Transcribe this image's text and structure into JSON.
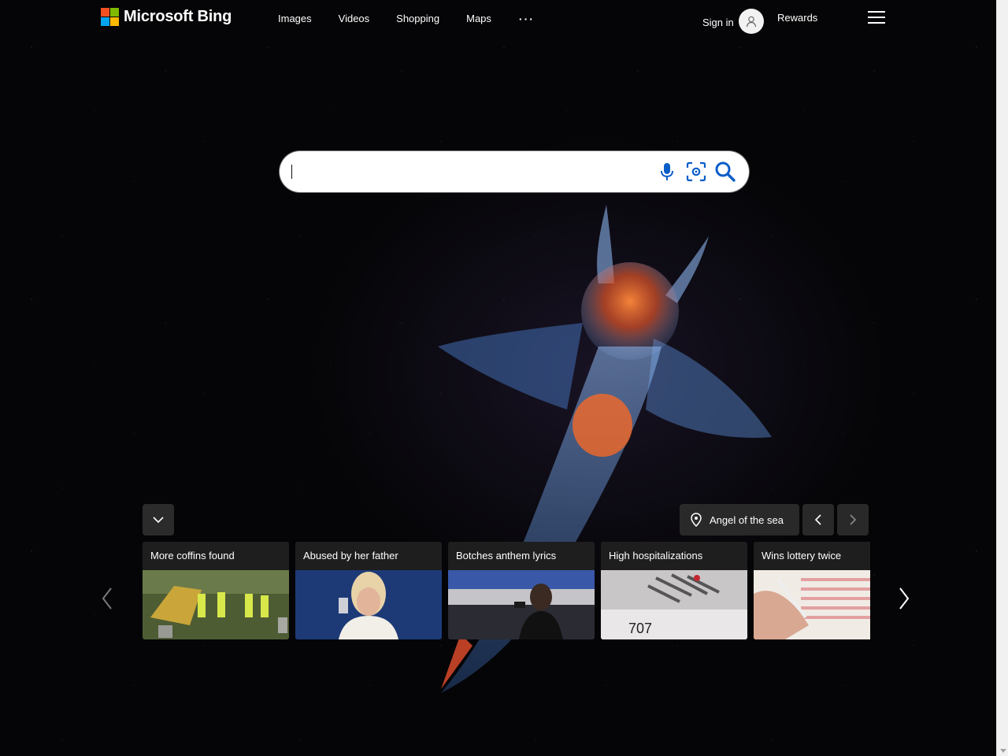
{
  "header": {
    "brand": "Microsoft Bing",
    "nav": [
      "Images",
      "Videos",
      "Shopping",
      "Maps"
    ],
    "more_label": "···",
    "signin_label": "Sign in",
    "rewards_label": "Rewards"
  },
  "search": {
    "value": "",
    "placeholder": ""
  },
  "image_info": {
    "location_label": "Angel of the sea"
  },
  "news": [
    {
      "title": "More coffins found",
      "thumb_colors": [
        "#5d6f3c",
        "#c9a53a",
        "#3d4a2a"
      ]
    },
    {
      "title": "Abused by her father",
      "thumb_colors": [
        "#1d3a77",
        "#d7b79a",
        "#f2efe8"
      ]
    },
    {
      "title": "Botches anthem lyrics",
      "thumb_colors": [
        "#2b2b33",
        "#3a58a8",
        "#111111"
      ]
    },
    {
      "title": "High hospitalizations",
      "thumb_colors": [
        "#c9c6c8",
        "#a9a3a8",
        "#7a1f28"
      ]
    },
    {
      "title": "Wins lottery twice",
      "thumb_colors": [
        "#e8cfc0",
        "#d9a892",
        "#f1ebe6"
      ]
    }
  ],
  "colors": {
    "ms_red": "#f25022",
    "ms_green": "#7fba00",
    "ms_blue": "#00a4ef",
    "ms_yellow": "#ffb900",
    "search_icon": "#0b5ec9"
  }
}
